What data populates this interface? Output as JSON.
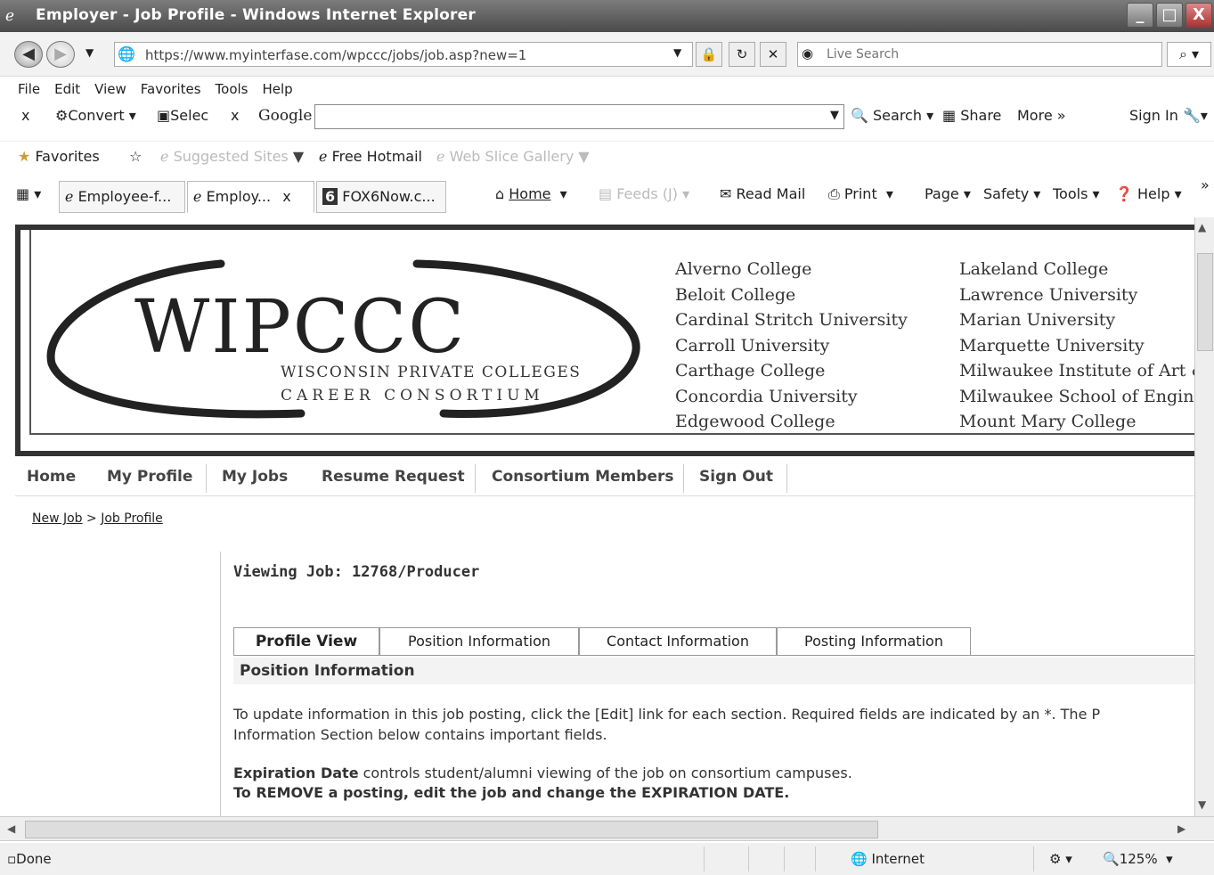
{
  "window": {
    "title": "Employer - Job Profile - Windows Internet Explorer",
    "minimize": "_",
    "restore": "□",
    "close": "X"
  },
  "address_bar": {
    "url": "https://www.myinterfase.com/wpccc/jobs/job.asp?new=1",
    "live_search_placeholder": "Live Search"
  },
  "menu": [
    "File",
    "Edit",
    "View",
    "Favorites",
    "Tools",
    "Help"
  ],
  "google_toolbar": {
    "close": "x",
    "convert": "Convert",
    "select": "Selec",
    "close2": "x",
    "google": "Google",
    "search": "Search",
    "share": "Share",
    "more": "More »",
    "sign_in": "Sign In"
  },
  "favorites_bar": {
    "favorites": "Favorites",
    "suggested_sites": "Suggested Sites",
    "free_hotmail": "Free Hotmail",
    "web_slice_gallery": "Web Slice Gallery"
  },
  "browser_tabs": [
    {
      "label": "Employee-f..."
    },
    {
      "label": "Employ..."
    },
    {
      "label": "FOX6Now.c..."
    }
  ],
  "command_bar": {
    "home": "Home",
    "feeds": "Feeds (J)",
    "read_mail": "Read Mail",
    "print": "Print",
    "page": "Page",
    "safety": "Safety",
    "tools": "Tools",
    "help": "Help"
  },
  "banner": {
    "logo": "WIPCCC",
    "subtitle1": "WISCONSIN PRIVATE COLLEGES",
    "subtitle2": "CAREER CONSORTIUM",
    "colleges_col1": [
      "Alverno College",
      "Beloit College",
      "Cardinal Stritch University",
      "Carroll University",
      "Carthage College",
      "Concordia University",
      "Edgewood College"
    ],
    "colleges_col2": [
      "Lakeland College",
      "Lawrence University",
      "Marian University",
      "Marquette University",
      "Milwaukee Institute of Art &",
      "Milwaukee School of Enginee",
      "Mount Mary College"
    ]
  },
  "site_nav": [
    "Home",
    "My Profile",
    "My Jobs",
    "Resume Request",
    "Consortium Members",
    "Sign Out"
  ],
  "breadcrumb": {
    "new_job": "New Job",
    "sep": ">",
    "job_profile": "Job Profile"
  },
  "main": {
    "viewing": "Viewing Job: 12768/Producer",
    "tabs": [
      "Profile View",
      "Position Information",
      "Contact Information",
      "Posting Information"
    ],
    "section_title": "Position Information",
    "para1_line1": "To update information in this job posting, click the [Edit] link for each section. Required fields are indicated by an *. The P",
    "para1_line2": "Information Section below contains important fields.",
    "para2_bold": "Expiration Date",
    "para2_rest": " controls student/alumni viewing of the job on consortium campuses.",
    "para3": "To REMOVE a posting, edit the job and change the EXPIRATION DATE."
  },
  "status_bar": {
    "status": "Done",
    "zone": "Internet",
    "zoom": "125%"
  }
}
